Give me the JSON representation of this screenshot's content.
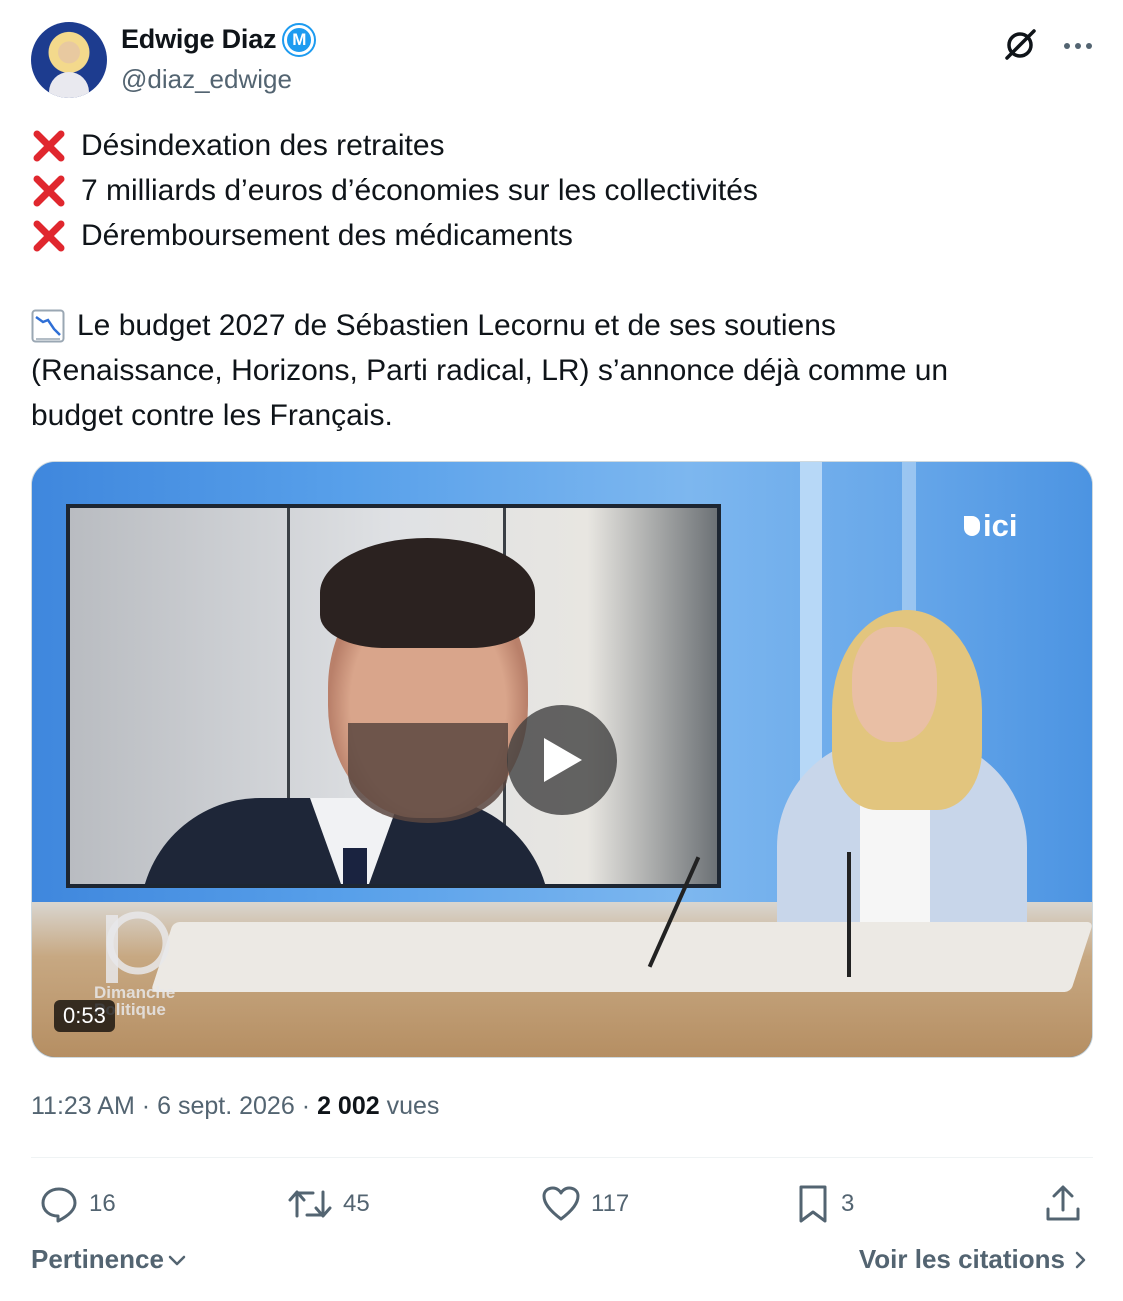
{
  "author": {
    "name": "Edwige Diaz",
    "handle": "@diaz_edwige",
    "badge_letter": "M",
    "badge_color": "#1d9bf0"
  },
  "header_icons": [
    "grok-icon",
    "more-icon"
  ],
  "tweet": {
    "bullets": [
      "Désindexation des retraites",
      "7 milliards d’euros d’économies sur les collectivités",
      "Déremboursement des médicaments"
    ],
    "paragraph_lines": [
      "Le budget 2027 de Sébastien Lecornu et de ses soutiens",
      "(Renaissance, Horizons, Parti radical, LR) s’annonce déjà comme un",
      "budget contre les Français."
    ]
  },
  "media": {
    "channel_logo": "ici",
    "show_logo_line1": "Dimanche",
    "show_logo_line2": "Politique",
    "duration": "0:53"
  },
  "meta": {
    "time": "11:23 AM",
    "separator": "·",
    "date": "6 sept. 2026",
    "views_count": "2 002",
    "views_label": "vues"
  },
  "actions": {
    "replies": "16",
    "reposts": "45",
    "likes": "117",
    "bookmarks": "3"
  },
  "footer": {
    "sort_label": "Pertinence",
    "quotes_label": "Voir les citations"
  },
  "colors": {
    "text_primary": "#0f1419",
    "text_secondary": "#536471",
    "accent": "#1d9bf0",
    "x_mark": "#e0272e"
  }
}
